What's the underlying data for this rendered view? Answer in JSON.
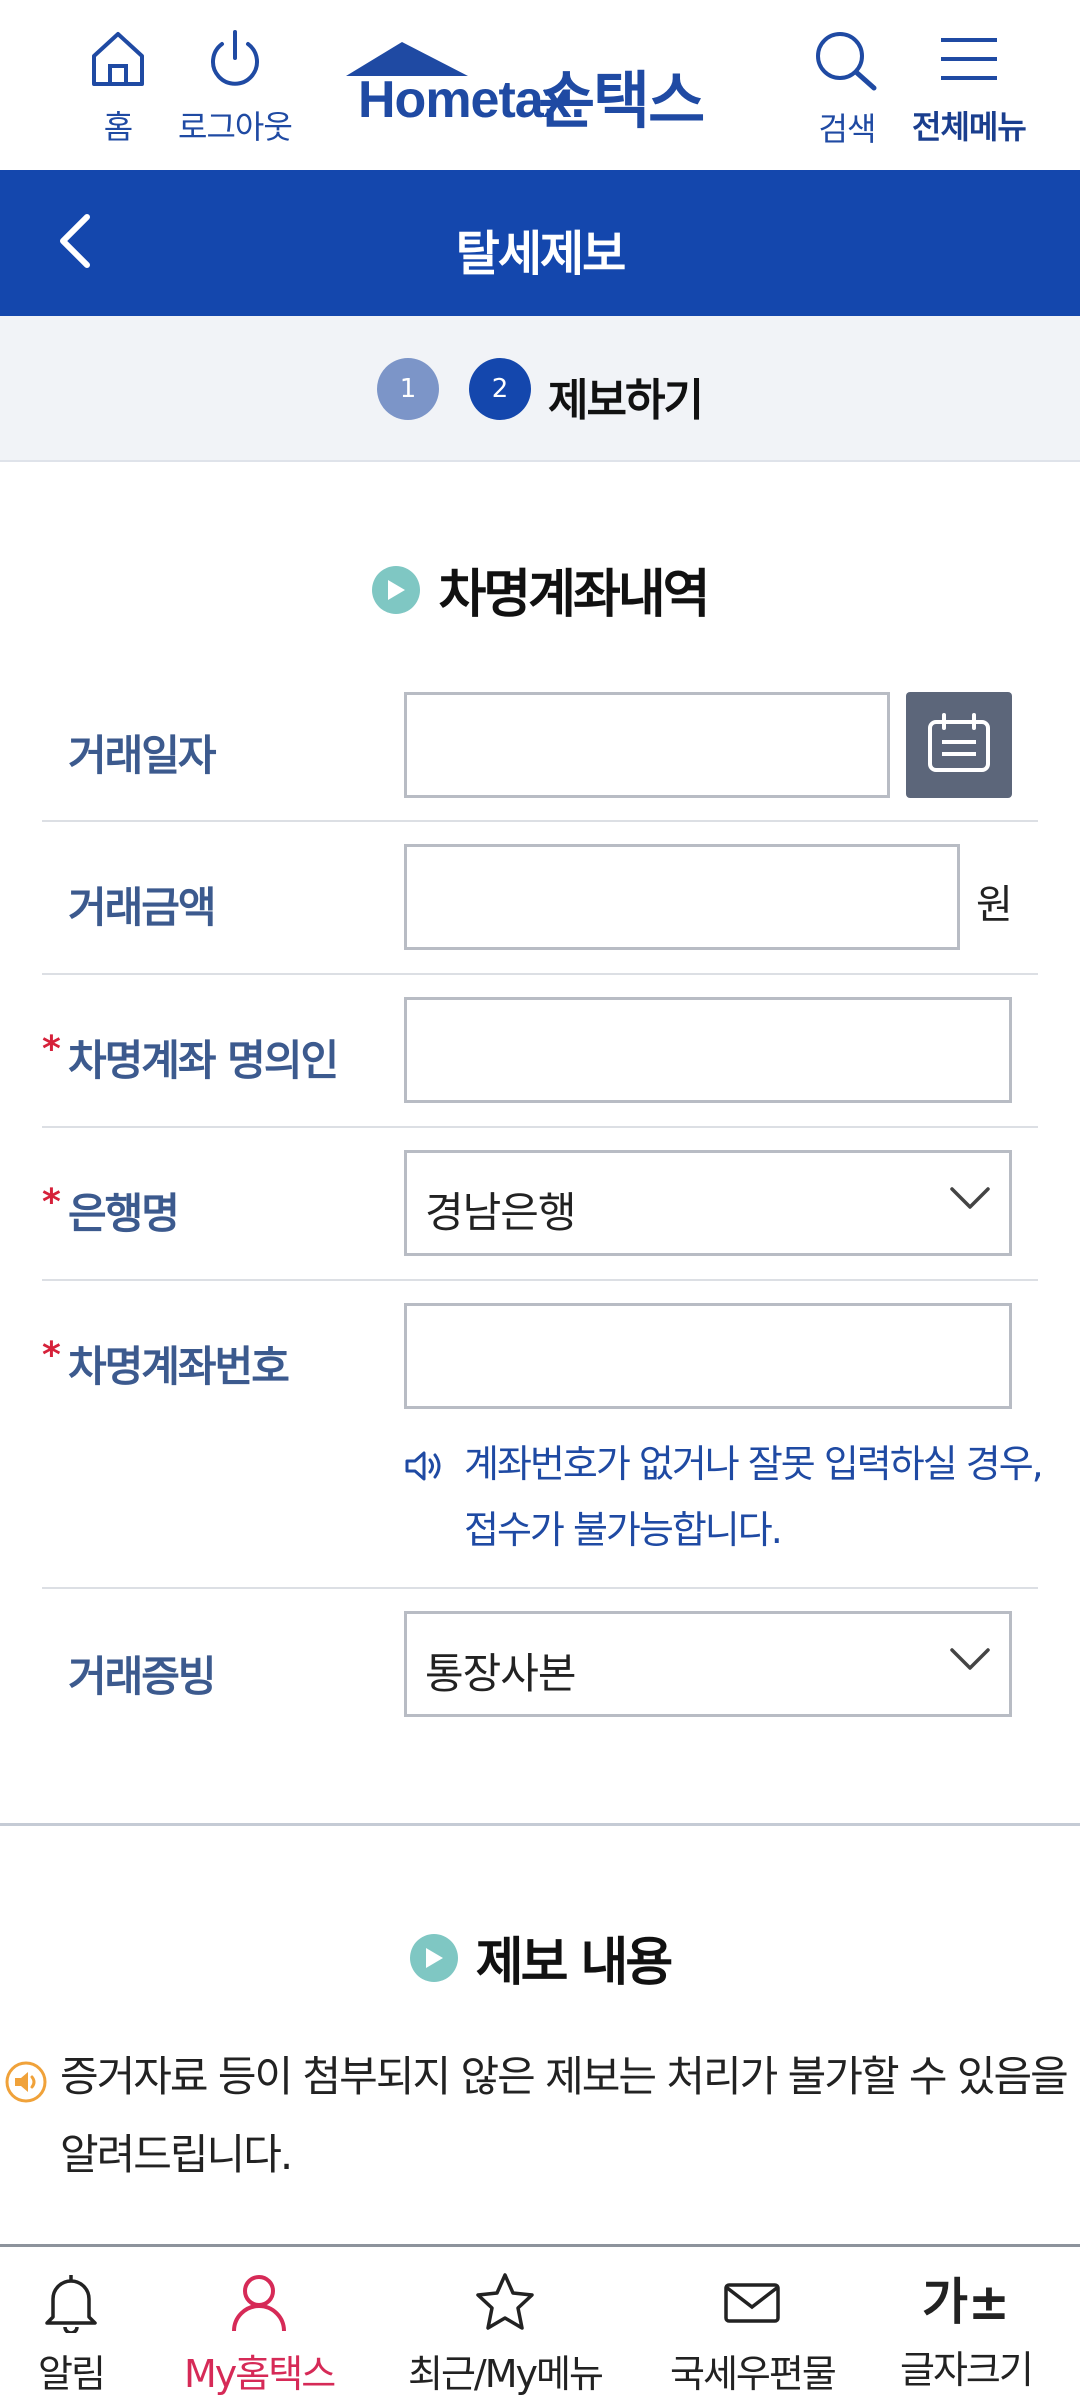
{
  "header": {
    "home_label": "홈",
    "logout_label": "로그아웃",
    "logo_text": "Hometax.",
    "logo_kr": "손택스",
    "search_label": "검색",
    "menu_label": "전체메뉴"
  },
  "titlebar": {
    "title": "탈세제보"
  },
  "steps": {
    "step1": "1",
    "step2": "2",
    "current_label": "제보하기"
  },
  "section1": {
    "title": "차명계좌내역",
    "rows": {
      "date_label": "거래일자",
      "amount_label": "거래금액",
      "amount_unit": "원",
      "holder_label": "차명계좌 명의인",
      "bank_label": "은행명",
      "bank_value": "경남은행",
      "account_label": "차명계좌번호",
      "account_notice": "계좌번호가 없거나 잘못 입력하실 경우, 접수가 불가능합니다.",
      "proof_label": "거래증빙",
      "proof_value": "통장사본",
      "required_mark": "*"
    }
  },
  "section2": {
    "title": "제보 내용",
    "warning": "증거자료 등이 첨부되지 않은 제보는 처리가 불가할 수 있음을 알려드립니다."
  },
  "bottom_nav": {
    "alarm": "알림",
    "my": "My홈택스",
    "recent": "최근/My메뉴",
    "post": "국세우편물",
    "font": "글자크기",
    "font_glyph": "가±"
  },
  "colors": {
    "brand_blue": "#1447ad",
    "label_blue": "#3c5a8e",
    "accent_red": "#d6213a",
    "active_pink": "#d62a57",
    "section_dot": "#7fc7c3"
  }
}
